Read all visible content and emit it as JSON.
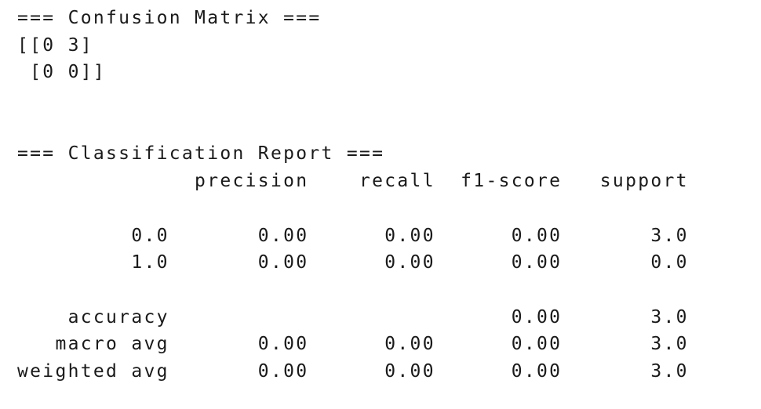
{
  "console_output": {
    "lines": [
      "=== Confusion Matrix ===",
      "[[0 3]",
      " [0 0]]",
      "",
      "",
      "=== Classification Report ===",
      "              precision    recall  f1-score   support",
      "",
      "         0.0       0.00      0.00      0.00       3.0",
      "         1.0       0.00      0.00      0.00       0.0",
      "",
      "    accuracy                           0.00       3.0",
      "   macro avg       0.00      0.00      0.00       3.0",
      "weighted avg       0.00      0.00      0.00       3.0"
    ]
  }
}
